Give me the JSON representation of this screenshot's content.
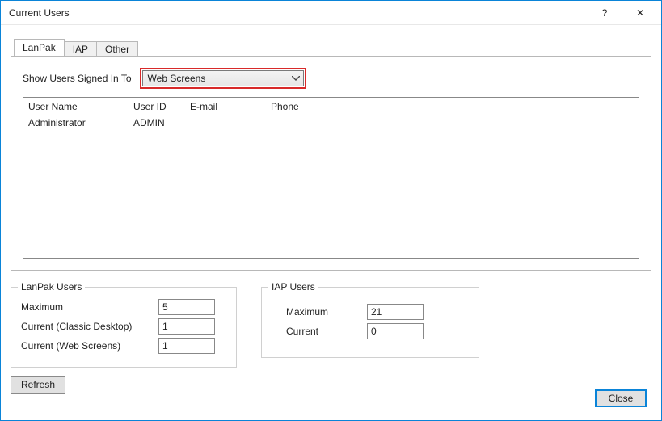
{
  "window": {
    "title": "Current Users",
    "help_icon": "?",
    "close_icon": "✕"
  },
  "tabs": [
    {
      "label": "LanPak",
      "active": true
    },
    {
      "label": "IAP",
      "active": false
    },
    {
      "label": "Other",
      "active": false
    }
  ],
  "filter": {
    "label": "Show Users Signed In To",
    "selected": "Web Screens"
  },
  "grid": {
    "columns": [
      "User Name",
      "User ID",
      "E-mail",
      "Phone"
    ],
    "rows": [
      {
        "user_name": "Administrator",
        "user_id": "ADMIN",
        "email": "",
        "phone": ""
      }
    ]
  },
  "lanpak_users": {
    "legend": "LanPak Users",
    "rows": [
      {
        "label": "Maximum",
        "value": "5"
      },
      {
        "label": "Current (Classic Desktop)",
        "value": "1"
      },
      {
        "label": "Current (Web Screens)",
        "value": "1"
      }
    ]
  },
  "iap_users": {
    "legend": "IAP Users",
    "rows": [
      {
        "label": "Maximum",
        "value": "21"
      },
      {
        "label": "Current",
        "value": "0"
      }
    ]
  },
  "buttons": {
    "refresh": "Refresh",
    "close": "Close"
  }
}
